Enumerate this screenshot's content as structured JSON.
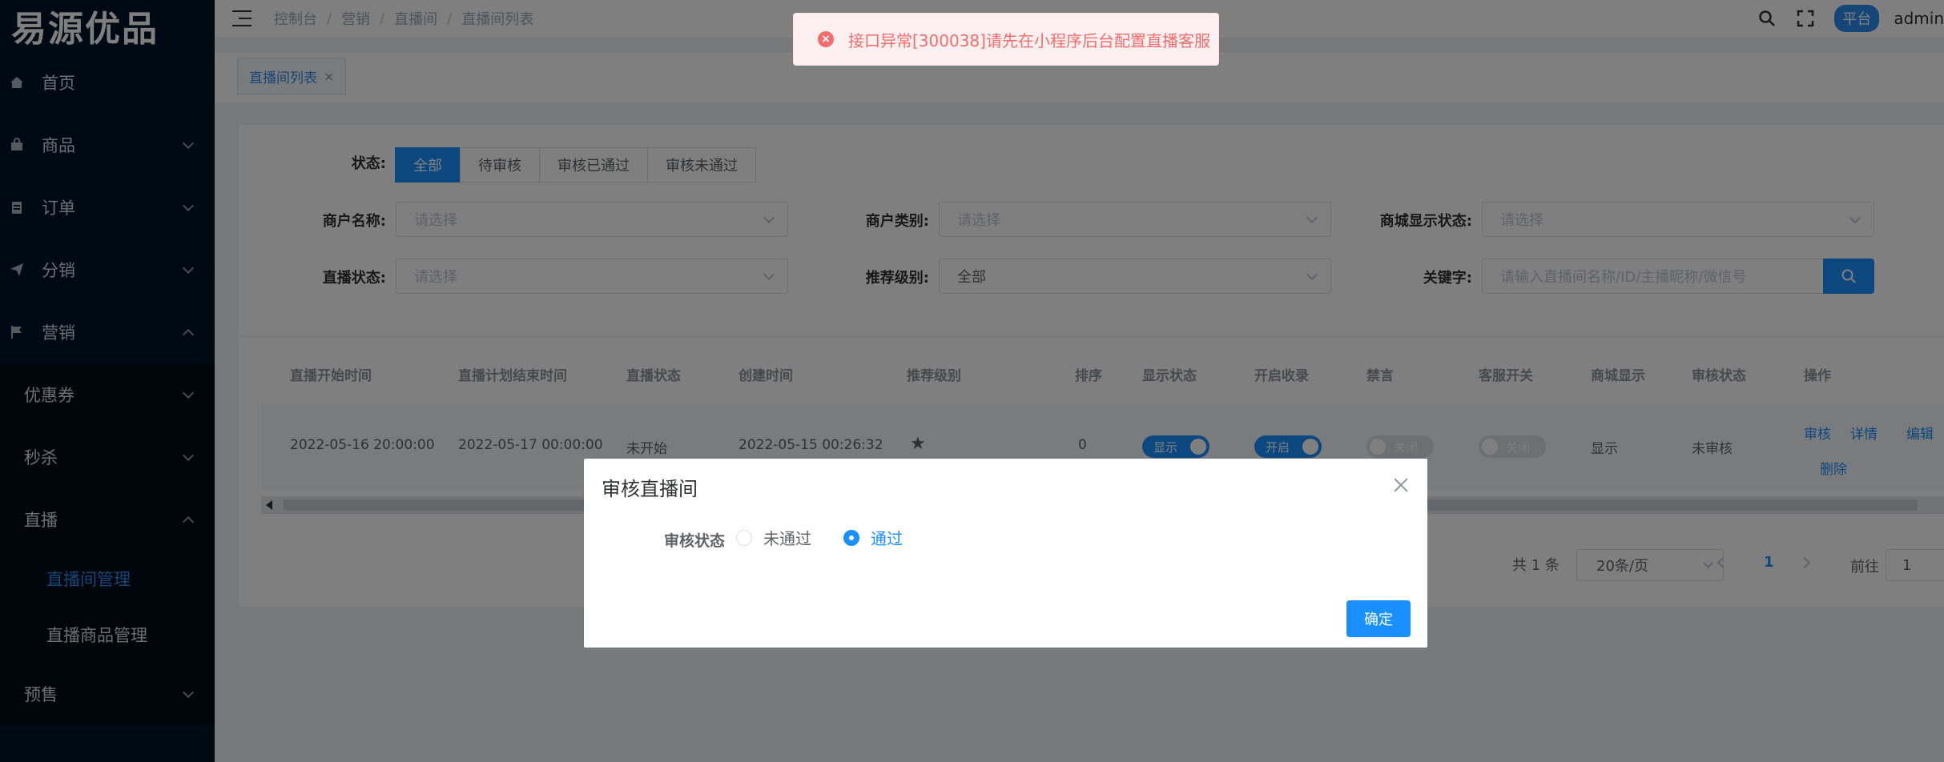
{
  "app": {
    "logo": "易源优品"
  },
  "sidebar": {
    "items": [
      {
        "label": "首页"
      },
      {
        "label": "商品"
      },
      {
        "label": "订单"
      },
      {
        "label": "分销"
      },
      {
        "label": "营销"
      }
    ],
    "marketing_sub": [
      {
        "label": "优惠券"
      },
      {
        "label": "秒杀"
      },
      {
        "label": "直播"
      }
    ],
    "live_sub": [
      {
        "label": "直播间管理"
      },
      {
        "label": "直播商品管理"
      }
    ],
    "presale": {
      "label": "预售"
    }
  },
  "header": {
    "breadcrumb": [
      "控制台",
      "营销",
      "直播间",
      "直播间列表"
    ],
    "separator": "/",
    "platform_badge": "平台",
    "user": "admin"
  },
  "tags": {
    "active": "直播间列表",
    "close": "×"
  },
  "filters": {
    "status_label": "状态:",
    "status_tabs": [
      "全部",
      "待审核",
      "审核已通过",
      "审核未通过"
    ],
    "merchant_name_label": "商户名称:",
    "merchant_name_placeholder": "请选择",
    "merchant_type_label": "商户类别:",
    "merchant_type_placeholder": "请选择",
    "mall_display_label": "商城显示状态:",
    "mall_display_placeholder": "请选择",
    "live_status_label": "直播状态:",
    "live_status_placeholder": "请选择",
    "recommend_label": "推荐级别:",
    "recommend_value": "全部",
    "keyword_label": "关键字:",
    "keyword_placeholder": "请输入直播间名称/ID/主播昵称/微信号"
  },
  "table": {
    "headers": [
      "直播开始时间",
      "直播计划结束时间",
      "直播状态",
      "创建时间",
      "推荐级别",
      "排序",
      "显示状态",
      "开启收录",
      "禁言",
      "客服开关",
      "商城显示",
      "审核状态",
      "操作"
    ],
    "row": {
      "start": "2022-05-16 20:00:00",
      "end": "2022-05-17 00:00:00",
      "status": "未开始",
      "created": "2022-05-15 00:26:32",
      "star": "★",
      "sort": "0",
      "display_switch": "显示",
      "record_switch": "开启",
      "mute_switch": "关闭",
      "service_switch": "关闭",
      "mall_display": "显示",
      "audit_status": "未审核",
      "actions": [
        "审核",
        "详情",
        "编辑",
        "删除"
      ]
    }
  },
  "pagination": {
    "total": "共 1 条",
    "page_size": "20条/页",
    "current": "1",
    "goto_label": "前往",
    "goto_value": "1"
  },
  "toast": {
    "icon": "×",
    "message": "接口异常[300038]请先在小程序后台配置直播客服"
  },
  "dialog": {
    "title": "审核直播间",
    "field_label": "审核状态",
    "options": [
      "未通过",
      "通过"
    ],
    "selected": "通过",
    "confirm": "确定"
  }
}
